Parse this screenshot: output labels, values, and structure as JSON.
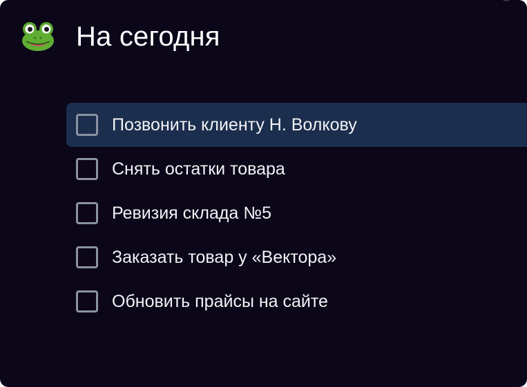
{
  "header": {
    "icon": "frog-icon",
    "title": "На сегодня"
  },
  "tasks": [
    {
      "label": "Позвонить клиенту Н. Волкову",
      "checked": false,
      "selected": true
    },
    {
      "label": "Снять остатки товара",
      "checked": false,
      "selected": false
    },
    {
      "label": "Ревизия склада №5",
      "checked": false,
      "selected": false
    },
    {
      "label": "Заказать товар у «Вектора»",
      "checked": false,
      "selected": false
    },
    {
      "label": "Обновить прайсы на сайте",
      "checked": false,
      "selected": false
    }
  ],
  "colors": {
    "background": "#0c0619",
    "selected_row": "#1b2e4d",
    "checkbox_border": "#8a93a4",
    "text": "#f2f2f5"
  }
}
